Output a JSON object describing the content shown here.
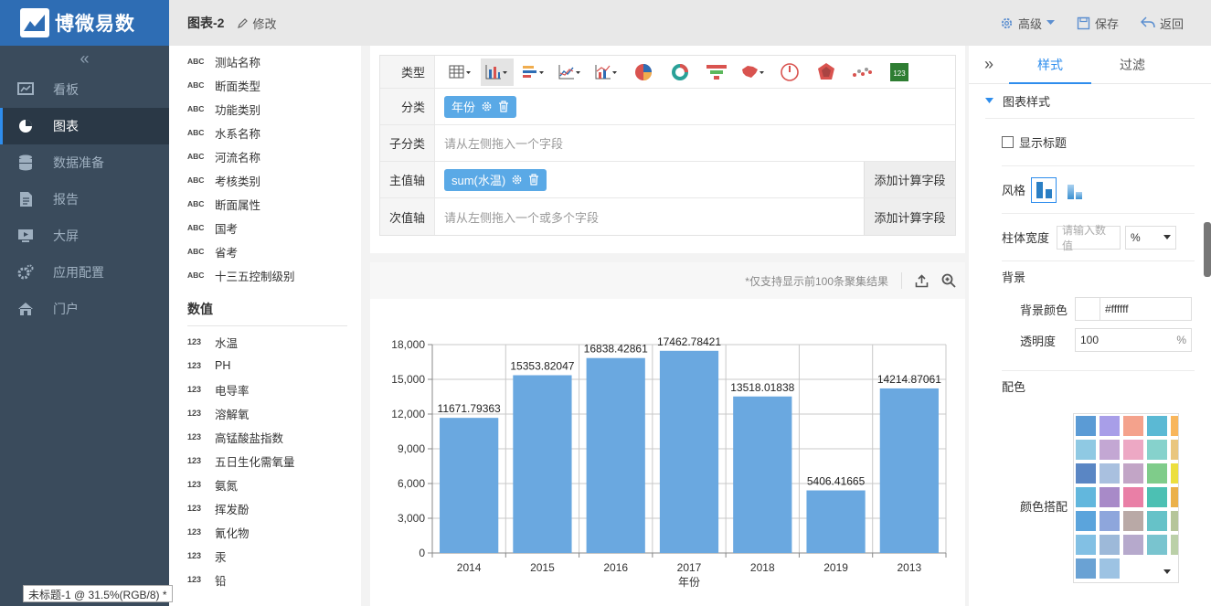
{
  "app": {
    "brand": "博微易数",
    "collapse_icon": "double-chevron-left",
    "status_text": "未标题-1 @ 31.5%(RGB/8) *"
  },
  "nav": [
    {
      "label": "看板",
      "icon": "dashboard-icon"
    },
    {
      "label": "图表",
      "icon": "pie-chart-icon",
      "active": true
    },
    {
      "label": "数据准备",
      "icon": "database-icon"
    },
    {
      "label": "报告",
      "icon": "document-icon"
    },
    {
      "label": "大屏",
      "icon": "screen-icon"
    },
    {
      "label": "应用配置",
      "icon": "gears-icon"
    },
    {
      "label": "门户",
      "icon": "home-icon"
    }
  ],
  "topbar": {
    "title": "图表-2",
    "edit": "修改",
    "advanced": "高级",
    "save": "保存",
    "back": "返回"
  },
  "fields": {
    "dimensions": [
      {
        "tag": "ABC",
        "name": "测站名称"
      },
      {
        "tag": "ABC",
        "name": "断面类型"
      },
      {
        "tag": "ABC",
        "name": "功能类别"
      },
      {
        "tag": "ABC",
        "name": "水系名称"
      },
      {
        "tag": "ABC",
        "name": "河流名称"
      },
      {
        "tag": "ABC",
        "name": "考核类别"
      },
      {
        "tag": "ABC",
        "name": "断面属性"
      },
      {
        "tag": "ABC",
        "name": "国考"
      },
      {
        "tag": "ABC",
        "name": "省考"
      },
      {
        "tag": "ABC",
        "name": "十三五控制级别"
      }
    ],
    "measure_title": "数值",
    "measures": [
      {
        "tag": "123",
        "name": "水温"
      },
      {
        "tag": "123",
        "name": "PH"
      },
      {
        "tag": "123",
        "name": "电导率"
      },
      {
        "tag": "123",
        "name": "溶解氧"
      },
      {
        "tag": "123",
        "name": "高锰酸盐指数"
      },
      {
        "tag": "123",
        "name": "五日生化需氧量"
      },
      {
        "tag": "123",
        "name": "氨氮"
      },
      {
        "tag": "123",
        "name": "挥发酚"
      },
      {
        "tag": "123",
        "name": "氰化物"
      },
      {
        "tag": "123",
        "name": "汞"
      },
      {
        "tag": "123",
        "name": "铅"
      }
    ]
  },
  "config": {
    "type_label": "类型",
    "category_label": "分类",
    "category_value": "年份",
    "subcategory_label": "子分类",
    "subcategory_placeholder": "请从左侧拖入一个字段",
    "primary_label": "主值轴",
    "primary_value": "sum(水温)",
    "secondary_label": "次值轴",
    "secondary_placeholder": "请从左侧拖入一个或多个字段",
    "calc_button": "添加计算字段",
    "chart_types": [
      "table",
      "column",
      "bar",
      "line",
      "combo",
      "pie",
      "donut",
      "funnel",
      "map",
      "gauge",
      "radar",
      "scatter",
      "kpi"
    ]
  },
  "chart_toolbar": {
    "note": "*仅支持显示前100条聚集结果"
  },
  "chart_data": {
    "type": "bar",
    "categories": [
      "2014",
      "2015",
      "2016",
      "2017",
      "2018",
      "2019",
      "2013"
    ],
    "values": [
      11671.79363,
      15353.82047,
      16838.42861,
      17462.78421,
      13518.01838,
      5406.41665,
      14214.87061
    ],
    "labels": [
      "11671.79363",
      "15353.82047",
      "16838.42861",
      "17462.78421",
      "13518.01838",
      "5406.41665",
      "14214.87061"
    ],
    "xlabel": "年份",
    "ylim": [
      0,
      18000
    ],
    "yticks": [
      0,
      3000,
      6000,
      9000,
      12000,
      15000,
      18000
    ],
    "ytick_labels": [
      "0",
      "3,000",
      "6,000",
      "9,000",
      "12,000",
      "15,000",
      "18,000"
    ],
    "color": "#6aa8e0",
    "grid": true
  },
  "right": {
    "tabs": [
      "样式",
      "过滤"
    ],
    "section_title": "图表样式",
    "show_title": "显示标题",
    "style_label": "风格",
    "bar_width_label": "柱体宽度",
    "bar_width_placeholder": "请输入数值",
    "bar_width_unit": "%",
    "bg_section": "背景",
    "bg_color_label": "背景颜色",
    "bg_color_value": "#ffffff",
    "opacity_label": "透明度",
    "opacity_value": "100",
    "opacity_unit": "%",
    "palette_section": "配色",
    "palette_label": "颜色搭配",
    "swatches": [
      "#5b9bd5",
      "#a89ee8",
      "#f4a28c",
      "#5bb9d4",
      "#f8b65c",
      "#8fc9e3",
      "#c3a7d3",
      "#eda8c4",
      "#86d2cc",
      "#e9c67f",
      "#5a86c4",
      "#a9c0df",
      "#c2a5c6",
      "#7fcc8a",
      "#ecdf3f",
      "#62b7dd",
      "#a88ac8",
      "#e97fa6",
      "#4cc0b3",
      "#ebb14a",
      "#5ba4dc",
      "#8ea6dc",
      "#b9a9a6",
      "#66c2c8",
      "#b6c59a",
      "#82c0e4",
      "#9db9d9",
      "#b6a9cc",
      "#79c4cf",
      "#bbd0a8",
      "#6aa2d4",
      "#9dc3e3"
    ]
  }
}
